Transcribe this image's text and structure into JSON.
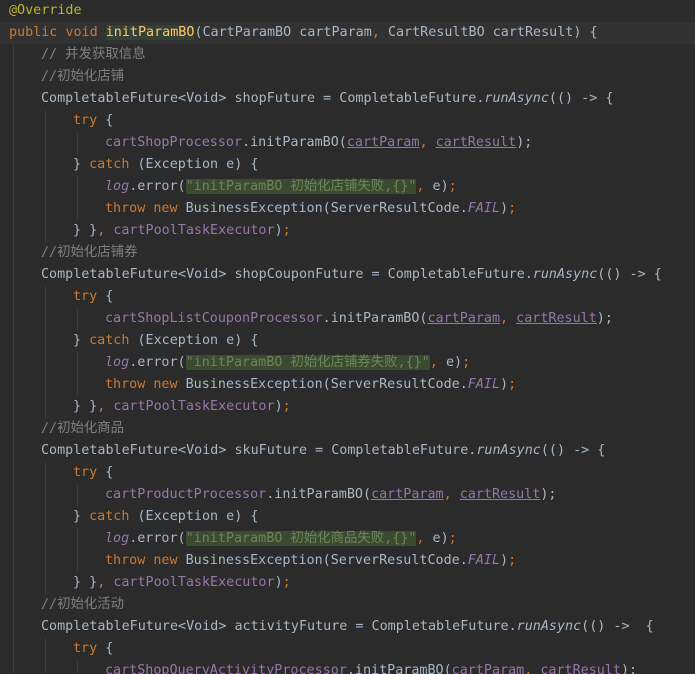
{
  "editor": {
    "language": "java",
    "theme": "darcula",
    "lines": [
      {
        "indent": 0,
        "current": false,
        "tokens": [
          {
            "t": "@Override",
            "c": "ann"
          }
        ]
      },
      {
        "indent": 0,
        "current": true,
        "tokens": [
          {
            "t": "public ",
            "c": "kw"
          },
          {
            "t": "void ",
            "c": "kw"
          },
          {
            "t": "initParamBO",
            "c": "fn mhl"
          },
          {
            "t": "(CartParamBO cartParam",
            "c": "pl"
          },
          {
            "t": ", ",
            "c": "kw"
          },
          {
            "t": "CartResultBO cartResult) {",
            "c": "pl"
          }
        ]
      },
      {
        "indent": 1,
        "current": false,
        "tokens": [
          {
            "t": "// 并发获取信息",
            "c": "cm"
          }
        ]
      },
      {
        "indent": 1,
        "current": false,
        "tokens": [
          {
            "t": "//初始化店铺",
            "c": "cm"
          }
        ]
      },
      {
        "indent": 1,
        "current": false,
        "tokens": [
          {
            "t": "CompletableFuture<Void> shopFuture = CompletableFuture.",
            "c": "pl"
          },
          {
            "t": "runAsync",
            "c": "sm"
          },
          {
            "t": "(() -> {",
            "c": "pl"
          }
        ]
      },
      {
        "indent": 2,
        "current": false,
        "tokens": [
          {
            "t": "try ",
            "c": "kw"
          },
          {
            "t": "{",
            "c": "pl"
          }
        ]
      },
      {
        "indent": 3,
        "current": false,
        "tokens": [
          {
            "t": "cartShopProcessor",
            "c": "field"
          },
          {
            "t": ".initParamBO(",
            "c": "pl"
          },
          {
            "t": "cartParam",
            "c": "fieldu"
          },
          {
            "t": ", ",
            "c": "kw"
          },
          {
            "t": "cartResult",
            "c": "fieldu"
          },
          {
            "t": ");",
            "c": "pl"
          }
        ]
      },
      {
        "indent": 2,
        "current": false,
        "tokens": [
          {
            "t": "} ",
            "c": "pl"
          },
          {
            "t": "catch ",
            "c": "kw"
          },
          {
            "t": "(Exception e) {",
            "c": "pl"
          }
        ]
      },
      {
        "indent": 3,
        "current": false,
        "tokens": [
          {
            "t": "log",
            "c": "static"
          },
          {
            "t": ".error(",
            "c": "pl"
          },
          {
            "t": "\"initParamBO 初始化店铺失败,{}\"",
            "c": "str"
          },
          {
            "t": ", ",
            "c": "kw"
          },
          {
            "t": "e)",
            "c": "pl"
          },
          {
            "t": ";",
            "c": "kw"
          }
        ]
      },
      {
        "indent": 3,
        "current": false,
        "tokens": [
          {
            "t": "throw new ",
            "c": "kw"
          },
          {
            "t": "BusinessException(ServerResultCode.",
            "c": "pl"
          },
          {
            "t": "FAIL",
            "c": "static"
          },
          {
            "t": ")",
            "c": "pl"
          },
          {
            "t": ";",
            "c": "kw"
          }
        ]
      },
      {
        "indent": 2,
        "current": false,
        "tokens": [
          {
            "t": "} }",
            "c": "pl"
          },
          {
            "t": ", ",
            "c": "kw"
          },
          {
            "t": "cartPoolTaskExecutor",
            "c": "field"
          },
          {
            "t": ")",
            "c": "pl"
          },
          {
            "t": ";",
            "c": "kw"
          }
        ]
      },
      {
        "indent": 1,
        "current": false,
        "tokens": [
          {
            "t": "//初始化店铺券",
            "c": "cm"
          }
        ]
      },
      {
        "indent": 1,
        "current": false,
        "tokens": [
          {
            "t": "CompletableFuture<Void> shopCouponFuture = CompletableFuture.",
            "c": "pl"
          },
          {
            "t": "runAsync",
            "c": "sm"
          },
          {
            "t": "(() -> {",
            "c": "pl"
          }
        ]
      },
      {
        "indent": 2,
        "current": false,
        "tokens": [
          {
            "t": "try ",
            "c": "kw"
          },
          {
            "t": "{",
            "c": "pl"
          }
        ]
      },
      {
        "indent": 3,
        "current": false,
        "tokens": [
          {
            "t": "cartShopListCouponProcessor",
            "c": "field"
          },
          {
            "t": ".initParamBO(",
            "c": "pl"
          },
          {
            "t": "cartParam",
            "c": "fieldu"
          },
          {
            "t": ", ",
            "c": "kw"
          },
          {
            "t": "cartResult",
            "c": "fieldu"
          },
          {
            "t": ");",
            "c": "pl"
          }
        ]
      },
      {
        "indent": 2,
        "current": false,
        "tokens": [
          {
            "t": "} ",
            "c": "pl"
          },
          {
            "t": "catch ",
            "c": "kw"
          },
          {
            "t": "(Exception e) {",
            "c": "pl"
          }
        ]
      },
      {
        "indent": 3,
        "current": false,
        "tokens": [
          {
            "t": "log",
            "c": "static"
          },
          {
            "t": ".error(",
            "c": "pl"
          },
          {
            "t": "\"initParamBO 初始化店铺券失败,{}\"",
            "c": "str"
          },
          {
            "t": ", ",
            "c": "kw"
          },
          {
            "t": "e)",
            "c": "pl"
          },
          {
            "t": ";",
            "c": "kw"
          }
        ]
      },
      {
        "indent": 3,
        "current": false,
        "tokens": [
          {
            "t": "throw new ",
            "c": "kw"
          },
          {
            "t": "BusinessException(ServerResultCode.",
            "c": "pl"
          },
          {
            "t": "FAIL",
            "c": "static"
          },
          {
            "t": ")",
            "c": "pl"
          },
          {
            "t": ";",
            "c": "kw"
          }
        ]
      },
      {
        "indent": 2,
        "current": false,
        "tokens": [
          {
            "t": "} }",
            "c": "pl"
          },
          {
            "t": ", ",
            "c": "kw"
          },
          {
            "t": "cartPoolTaskExecutor",
            "c": "field"
          },
          {
            "t": ")",
            "c": "pl"
          },
          {
            "t": ";",
            "c": "kw"
          }
        ]
      },
      {
        "indent": 1,
        "current": false,
        "tokens": [
          {
            "t": "//初始化商品",
            "c": "cm"
          }
        ]
      },
      {
        "indent": 1,
        "current": false,
        "tokens": [
          {
            "t": "CompletableFuture<Void> skuFuture = CompletableFuture.",
            "c": "pl"
          },
          {
            "t": "runAsync",
            "c": "sm"
          },
          {
            "t": "(() -> {",
            "c": "pl"
          }
        ]
      },
      {
        "indent": 2,
        "current": false,
        "tokens": [
          {
            "t": "try ",
            "c": "kw"
          },
          {
            "t": "{",
            "c": "pl"
          }
        ]
      },
      {
        "indent": 3,
        "current": false,
        "tokens": [
          {
            "t": "cartProductProcessor",
            "c": "field"
          },
          {
            "t": ".initParamBO(",
            "c": "pl"
          },
          {
            "t": "cartParam",
            "c": "fieldu"
          },
          {
            "t": ", ",
            "c": "kw"
          },
          {
            "t": "cartResult",
            "c": "fieldu"
          },
          {
            "t": ");",
            "c": "pl"
          }
        ]
      },
      {
        "indent": 2,
        "current": false,
        "tokens": [
          {
            "t": "} ",
            "c": "pl"
          },
          {
            "t": "catch ",
            "c": "kw"
          },
          {
            "t": "(Exception e) {",
            "c": "pl"
          }
        ]
      },
      {
        "indent": 3,
        "current": false,
        "tokens": [
          {
            "t": "log",
            "c": "static"
          },
          {
            "t": ".error(",
            "c": "pl"
          },
          {
            "t": "\"initParamBO 初始化商品失败,{}\"",
            "c": "str"
          },
          {
            "t": ", ",
            "c": "kw"
          },
          {
            "t": "e)",
            "c": "pl"
          },
          {
            "t": ";",
            "c": "kw"
          }
        ]
      },
      {
        "indent": 3,
        "current": false,
        "tokens": [
          {
            "t": "throw new ",
            "c": "kw"
          },
          {
            "t": "BusinessException(ServerResultCode.",
            "c": "pl"
          },
          {
            "t": "FAIL",
            "c": "static"
          },
          {
            "t": ")",
            "c": "pl"
          },
          {
            "t": ";",
            "c": "kw"
          }
        ]
      },
      {
        "indent": 2,
        "current": false,
        "tokens": [
          {
            "t": "} }",
            "c": "pl"
          },
          {
            "t": ", ",
            "c": "kw"
          },
          {
            "t": "cartPoolTaskExecutor",
            "c": "field"
          },
          {
            "t": ")",
            "c": "pl"
          },
          {
            "t": ";",
            "c": "kw"
          }
        ]
      },
      {
        "indent": 1,
        "current": false,
        "tokens": [
          {
            "t": "//初始化活动",
            "c": "cm"
          }
        ]
      },
      {
        "indent": 1,
        "current": false,
        "tokens": [
          {
            "t": "CompletableFuture<Void> activityFuture = CompletableFuture.",
            "c": "pl"
          },
          {
            "t": "runAsync",
            "c": "sm"
          },
          {
            "t": "(() ->  {",
            "c": "pl"
          }
        ]
      },
      {
        "indent": 2,
        "current": false,
        "tokens": [
          {
            "t": "try ",
            "c": "kw"
          },
          {
            "t": "{",
            "c": "pl"
          }
        ]
      },
      {
        "indent": 3,
        "current": false,
        "tokens": [
          {
            "t": "cartShopQueryActivityProcessor",
            "c": "field"
          },
          {
            "t": ".initParamBO(",
            "c": "pl"
          },
          {
            "t": "cartParam",
            "c": "fieldu"
          },
          {
            "t": ", ",
            "c": "kw"
          },
          {
            "t": "cartResult",
            "c": "fieldu"
          },
          {
            "t": ");",
            "c": "pl"
          }
        ]
      }
    ]
  }
}
